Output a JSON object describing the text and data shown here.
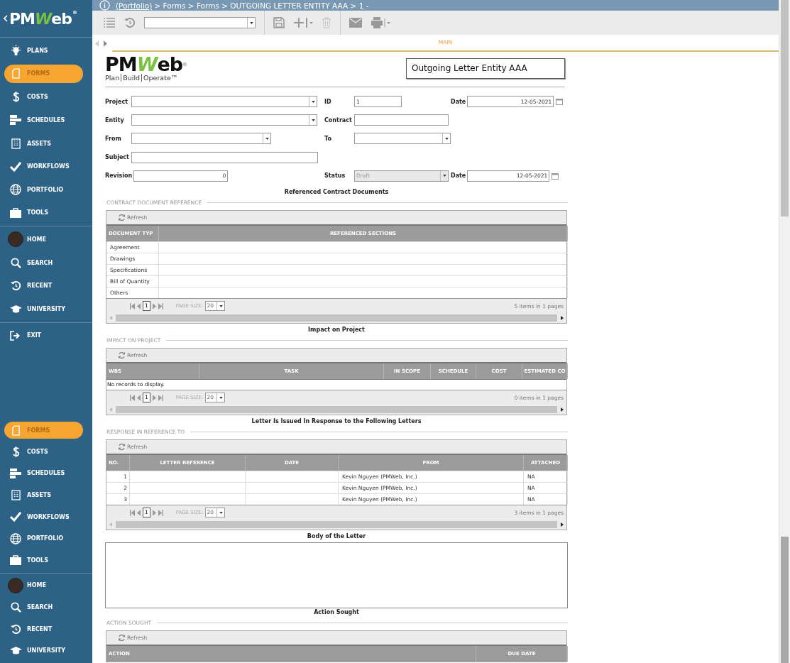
{
  "sidebar": {
    "logo": {
      "parts": [
        "PM",
        "W",
        "eb"
      ],
      "mark": "®"
    },
    "groups": [
      {
        "items": [
          {
            "label": "PLANS",
            "kind": "bulb",
            "selected": false
          },
          {
            "label": "FORMS",
            "kind": "doc",
            "selected": true
          },
          {
            "label": "COSTS",
            "kind": "dollar",
            "selected": false
          },
          {
            "label": "SCHEDULES",
            "kind": "bars",
            "selected": false
          },
          {
            "label": "ASSETS",
            "kind": "building",
            "selected": false
          },
          {
            "label": "WORKFLOWS",
            "kind": "check",
            "selected": false
          },
          {
            "label": "PORTFOLIO",
            "kind": "globe",
            "selected": false
          },
          {
            "label": "TOOLS",
            "kind": "briefcase",
            "selected": false
          }
        ]
      },
      {
        "items": [
          {
            "label": "HOME",
            "kind": "avatar",
            "selected": false
          },
          {
            "label": "SEARCH",
            "kind": "search",
            "selected": false
          },
          {
            "label": "RECENT",
            "kind": "history",
            "selected": false
          },
          {
            "label": "UNIVERSITY",
            "kind": "cap",
            "selected": false
          }
        ]
      },
      {
        "items": [
          {
            "label": "EXIT",
            "kind": "exit",
            "selected": false
          }
        ]
      },
      {
        "items": [
          {
            "label": "FORMS",
            "kind": "doc",
            "selected": true
          },
          {
            "label": "COSTS",
            "kind": "dollar",
            "selected": false
          },
          {
            "label": "SCHEDULES",
            "kind": "bars",
            "selected": false
          },
          {
            "label": "ASSETS",
            "kind": "building",
            "selected": false
          },
          {
            "label": "WORKFLOWS",
            "kind": "check",
            "selected": false
          },
          {
            "label": "PORTFOLIO",
            "kind": "globe",
            "selected": false
          },
          {
            "label": "TOOLS",
            "kind": "briefcase",
            "selected": false
          }
        ]
      },
      {
        "items": [
          {
            "label": "HOME",
            "kind": "avatar",
            "selected": false
          },
          {
            "label": "SEARCH",
            "kind": "search",
            "selected": false
          },
          {
            "label": "RECENT",
            "kind": "history",
            "selected": false
          },
          {
            "label": "UNIVERSITY",
            "kind": "cap",
            "selected": false
          }
        ]
      }
    ]
  },
  "breadcrumb": {
    "link": "(Portfolio)",
    "path": "> Forms > Forms > OUTGOING LETTER ENTITY AAA > 1 -"
  },
  "tabs": [
    {
      "label": "MAIN",
      "selected": true
    }
  ],
  "form": {
    "logo": {
      "parts": [
        "PM",
        "W",
        "eb"
      ],
      "mark": "®",
      "tagline": [
        "Plan",
        "Build",
        "Operate™"
      ]
    },
    "title": "Outgoing Letter Entity AAA",
    "rows": [
      [
        {
          "label": "Project",
          "kind": "select",
          "disabled": false
        },
        {
          "label": "ID",
          "kind": "text",
          "value": "1",
          "disabled": false
        },
        {
          "label": "Date",
          "kind": "date",
          "value": "12-05-2021",
          "disabled": false
        }
      ],
      [
        {
          "label": "Entity",
          "kind": "select",
          "disabled": false
        },
        {
          "label": "Contract",
          "kind": "text",
          "disabled": false
        }
      ],
      [
        {
          "label": "From",
          "kind": "select",
          "disabled": false
        },
        {
          "label": "To",
          "kind": "select",
          "disabled": false
        }
      ],
      [
        {
          "label": "Subject",
          "kind": "text",
          "disabled": false
        }
      ],
      [
        {
          "label": "Revision",
          "kind": "number",
          "value": "0",
          "disabled": false
        },
        {
          "label": "Status",
          "kind": "select",
          "value": "Draft",
          "disabled": true
        },
        {
          "label": "Date",
          "kind": "date",
          "value": "12-05-2021",
          "disabled": false
        }
      ]
    ],
    "sections": [
      {
        "kind": "grid",
        "caption": "Referenced Contract Documents",
        "legend": "CONTRACT DOCUMENT REFERENCE",
        "refresh": "Refresh",
        "columns": [
          "DOCUMENT TYP",
          "REFERENCED SECTIONS"
        ],
        "rows": [
          [
            "Agreement",
            ""
          ],
          [
            "Drawings",
            ""
          ],
          [
            "Specifications",
            ""
          ],
          [
            "Bill of Quantity",
            ""
          ],
          [
            "Others",
            ""
          ]
        ],
        "pager": {
          "page": "1",
          "page_size_label": "PAGE SIZE:",
          "page_size": "20",
          "summary": "5 items in 1 pages"
        }
      },
      {
        "kind": "grid",
        "caption": "Impact on Project",
        "legend": "IMPACT ON PROJECT",
        "refresh": "Refresh",
        "columns": [
          "WBS",
          "TASK",
          "IN SCOPE",
          "SCHEDULE",
          "COST",
          "ESTIMATED CO"
        ],
        "empty_text": "No records to display.",
        "pager": {
          "page": "1",
          "page_size_label": "PAGE SIZE:",
          "page_size": "20",
          "summary": "0 items in 1 pages"
        }
      },
      {
        "kind": "grid",
        "caption": "Letter Is Issued In Response to the Following Letters",
        "legend": "RESPONSE IN REFERENCE TO",
        "refresh": "Refresh",
        "columns": [
          "NO.",
          "LETTER REFERENCE",
          "DATE",
          "FROM",
          "ATTACHED"
        ],
        "rows": [
          [
            "1",
            "",
            "",
            "Kevin Nguyen (PMWeb, Inc.)",
            "NA"
          ],
          [
            "2",
            "",
            "",
            "Kevin Nguyen (PMWeb, Inc.)",
            "NA"
          ],
          [
            "3",
            "",
            "",
            "Kevin Nguyen (PMWeb, Inc.)",
            "NA"
          ]
        ],
        "pager": {
          "page": "1",
          "page_size_label": "PAGE SIZE:",
          "page_size": "20",
          "summary": "3 items in 1 pages"
        }
      },
      {
        "kind": "textarea",
        "caption": "Body of the Letter"
      },
      {
        "kind": "grid",
        "caption": "Action Sought",
        "legend": "ACTION SOUGHT",
        "refresh": "Refresh",
        "columns": [
          "ACTION",
          "DUE DATE"
        ]
      }
    ]
  }
}
